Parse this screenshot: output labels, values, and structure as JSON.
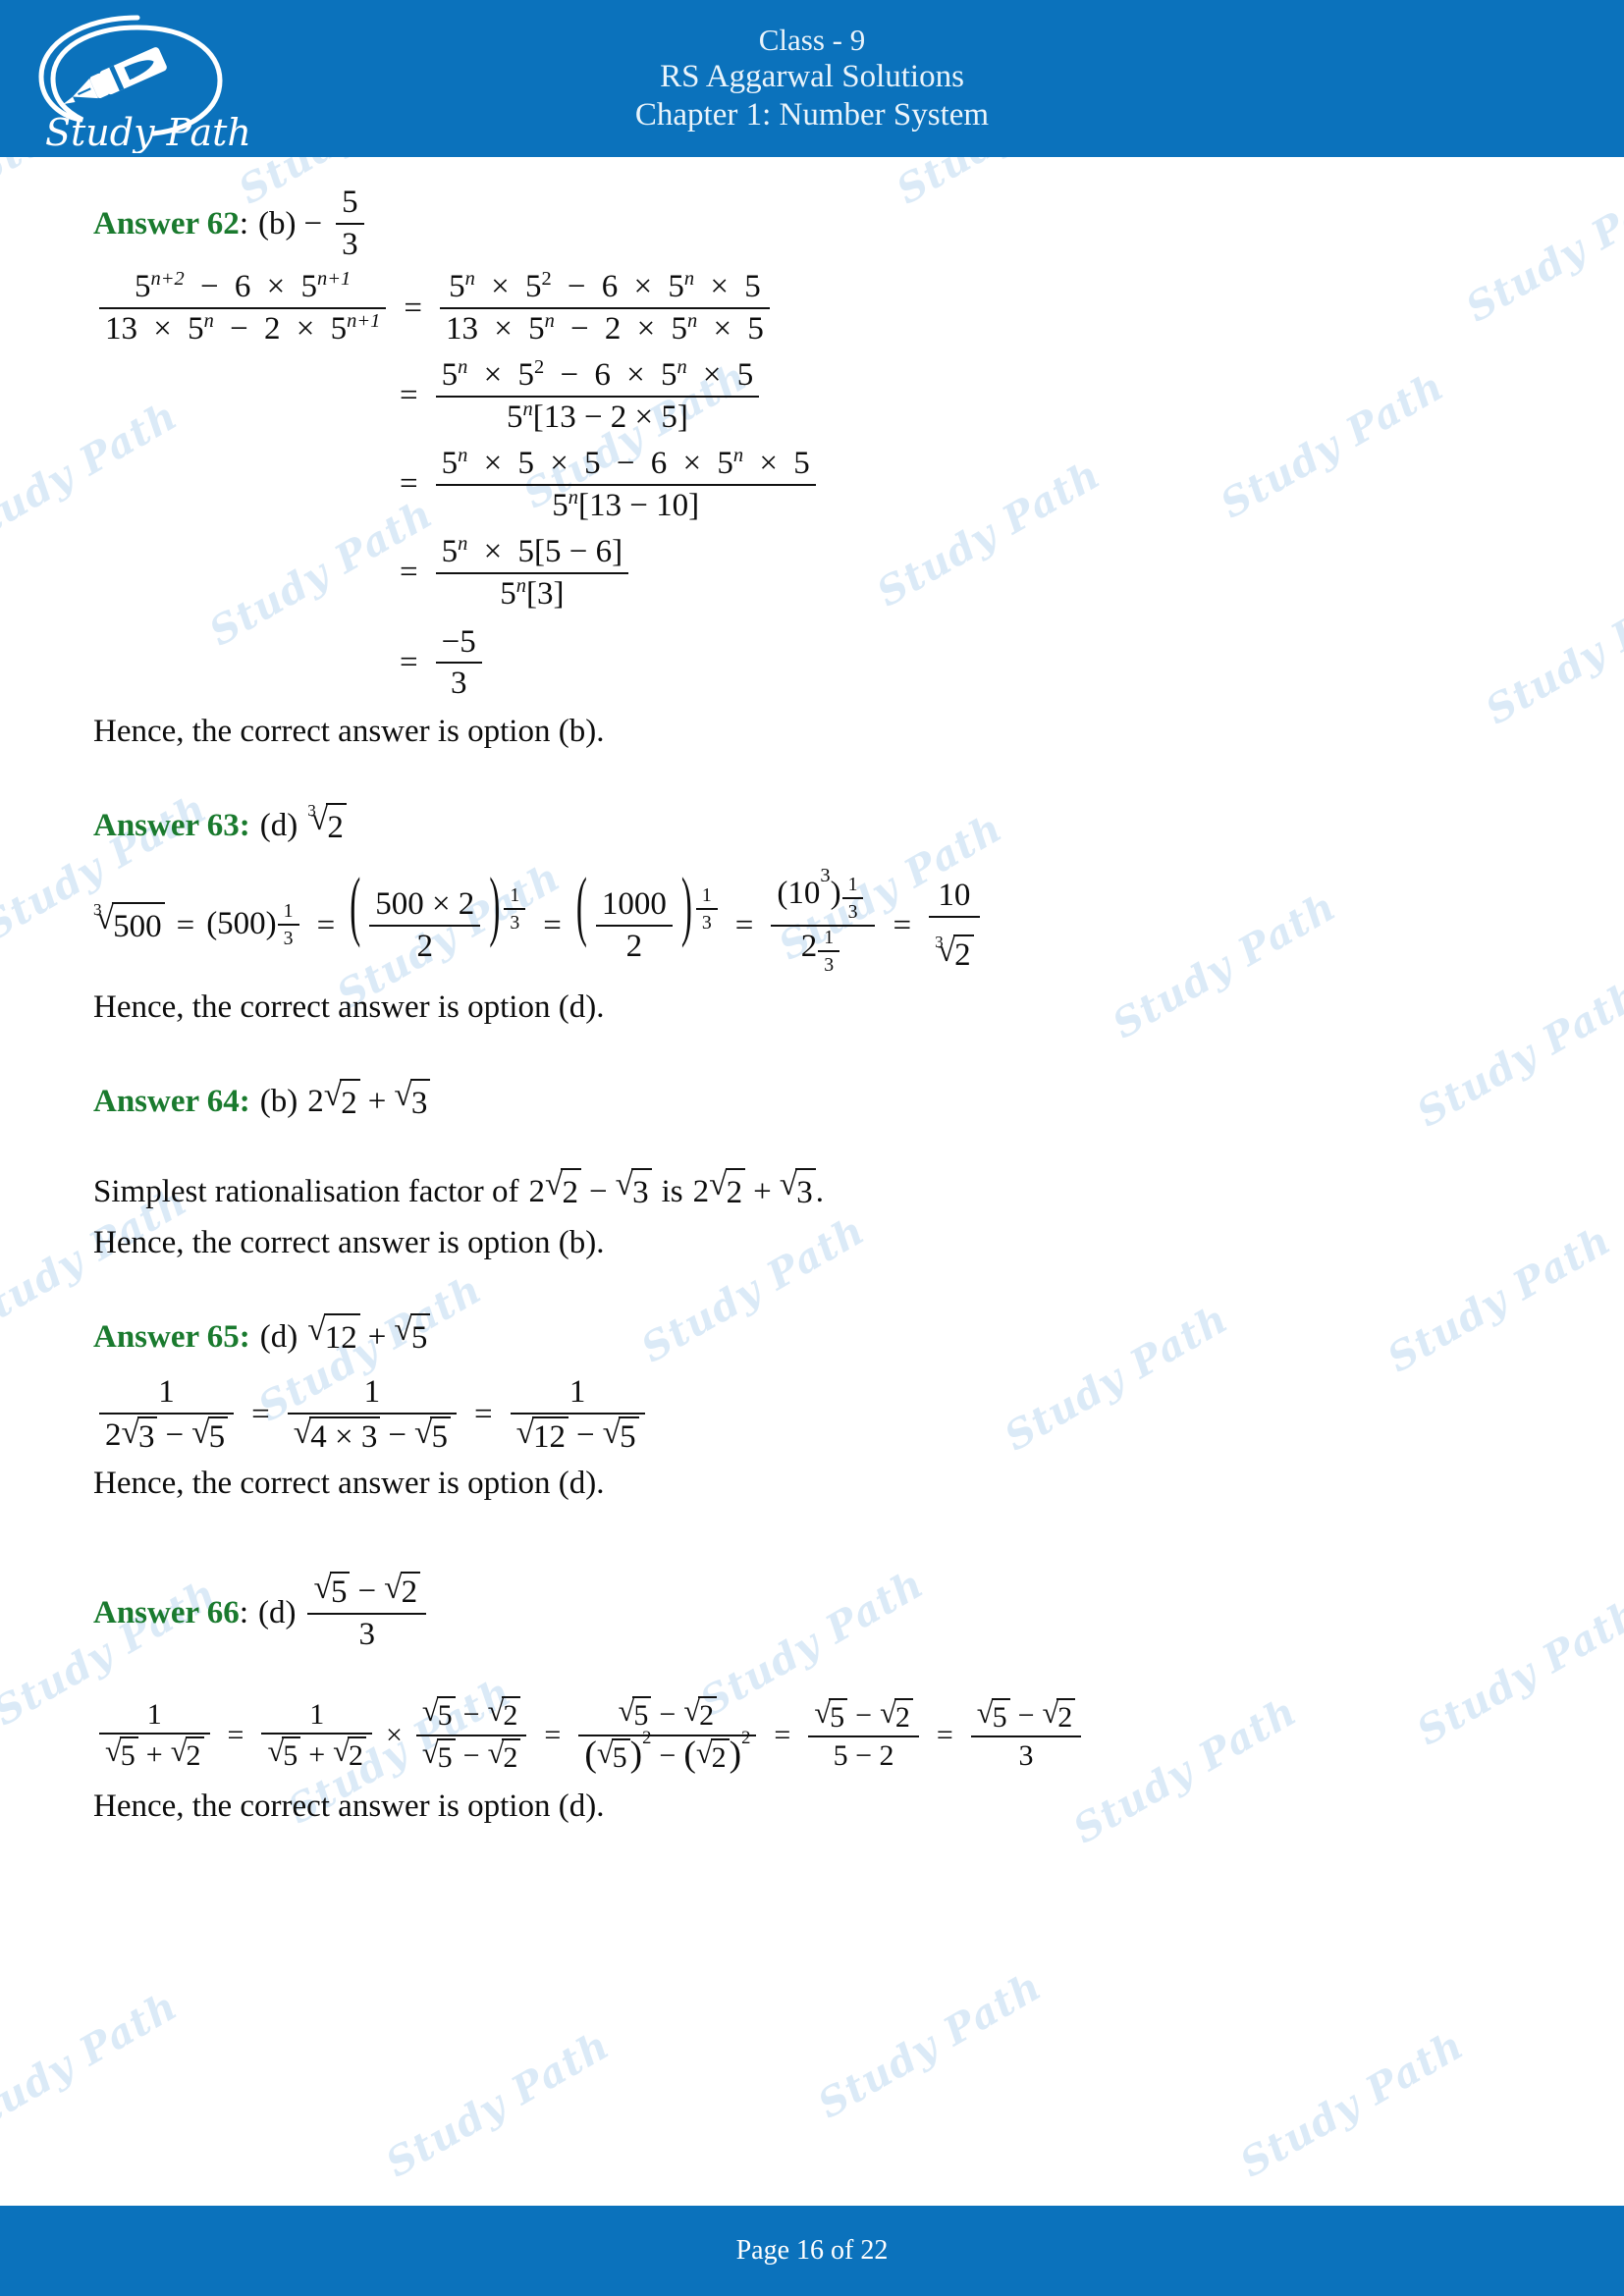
{
  "header": {
    "logo_alt": "Study Path",
    "logo_wordmark": "Study Path",
    "line1": "Class - 9",
    "line2": "RS Aggarwal Solutions",
    "line3": "Chapter 1: Number System",
    "bg_color": "#0B72BC",
    "text_color": "#eaf4fb"
  },
  "footer": {
    "page_text": "Page 16 of 22",
    "page_current": "16",
    "page_total": "22",
    "bg_color": "#0B72BC"
  },
  "watermark": {
    "text": "Study Path",
    "color": "#cfe4f5"
  },
  "answer_label_color": "#1a7a2e",
  "answers": [
    {
      "id": "62",
      "label": "Answer 62",
      "sep": ":",
      "option": "(b)",
      "result_sign": "−",
      "result_num": "5",
      "result_den": "3",
      "steps": {
        "s1_lhs_num": "5",
        "s1_lhs_num_exp": "n+2",
        "s1_lhs_num_rest_a": "6",
        "s1_lhs_num_rest_b": "5",
        "s1_lhs_num_rest_exp": "n+1",
        "s1_lhs_den_a": "13",
        "s1_lhs_den_b": "5",
        "s1_lhs_den_b_exp": "n",
        "s1_lhs_den_c": "2",
        "s1_lhs_den_d": "5",
        "s1_lhs_den_d_exp": "n+1",
        "s2_num": "5",
        "s2_num_exp": "n",
        "s2_num_b": "5",
        "s2_num_b_exp": "2",
        "s2_num_c": "6",
        "s2_num_d": "5",
        "s2_num_d_exp": "n",
        "s2_num_e": "5",
        "s2_den_a": "13",
        "s2_den_b": "5",
        "s2_den_b_exp": "n",
        "s2_den_c": "2",
        "s2_den_d": "5",
        "s2_den_d_exp": "n",
        "s2_den_e": "5",
        "s3_den_base": "5",
        "s3_den_exp": "n",
        "s3_den_bracket": "[13 − 2 × 5]",
        "s4_bracket": "[13 − 10]",
        "s5_num_bracket": "[5 − 6]",
        "s5_den_bracket": "[3]",
        "s6_num": "−5",
        "s6_den": "3"
      },
      "conclusion": "Hence, the correct answer is option (b)."
    },
    {
      "id": "63",
      "label": "Answer 63:",
      "option": "(d)",
      "result_index": "3",
      "result_radicand": "2",
      "steps": {
        "root_index": "3",
        "radicand": "500",
        "base": "(500)",
        "exp_num": "1",
        "exp_den": "3",
        "f1_num": "500 × 2",
        "f1_den": "2",
        "f2_num": "1000",
        "f2_den": "2",
        "f3_base": "(10",
        "f3_base_exp": "3",
        "f3_close": ")",
        "f3_den_base": "2",
        "f4_num": "10",
        "f4_den_index": "3",
        "f4_den_radicand": "2"
      },
      "conclusion": "Hence, the correct answer is option (d)."
    },
    {
      "id": "64",
      "label": "Answer 64:",
      "option": "(b)",
      "result_coeff": "2",
      "result_r1": "2",
      "result_op": "+",
      "result_r2": "3",
      "body_prefix": "Simplest rationalisation factor of",
      "body_a_coeff": "2",
      "body_a_r1": "2",
      "body_a_op": "−",
      "body_a_r2": "3",
      "body_mid": "is",
      "body_b_coeff": "2",
      "body_b_r1": "2",
      "body_b_op": "+",
      "body_b_r2": "3",
      "body_suffix": ".",
      "conclusion": "Hence, the correct answer is option (b)."
    },
    {
      "id": "65",
      "label": "Answer 65:",
      "option": "(d)",
      "result_r1": "12",
      "result_op": "+",
      "result_r2": "5",
      "steps": {
        "num": "1",
        "d1_coeff": "2",
        "d1_r1": "3",
        "d1_op": "−",
        "d1_r2": "5",
        "d2_r1": "4 × 3",
        "d2_op": "−",
        "d2_r2": "5",
        "d3_r1": "12",
        "d3_op": "−",
        "d3_r2": "5"
      },
      "conclusion": "Hence, the correct answer is option (d)."
    },
    {
      "id": "66",
      "label": "Answer 66",
      "sep": ":",
      "option": "(d)",
      "result_num_r1": "5",
      "result_num_op": "−",
      "result_num_r2": "2",
      "result_den": "3",
      "steps": {
        "num": "1",
        "den_r1": "5",
        "den_op": "+",
        "den_r2": "2",
        "mult_sign": "×",
        "f3_num_r1": "5",
        "f3_num_op": "−",
        "f3_num_r2": "2",
        "f3_den_r1": "5",
        "f3_den_op": "−",
        "f3_den_r2": "2",
        "f4_num_r1": "5",
        "f4_num_op": "−",
        "f4_num_r2": "2",
        "f4_den_a_r": "5",
        "f4_den_a_exp": "2",
        "f4_den_op": "−",
        "f4_den_b_r": "2",
        "f4_den_b_exp": "2",
        "f5_num_r1": "5",
        "f5_num_op": "−",
        "f5_num_r2": "2",
        "f5_den": "5 − 2",
        "f6_num_r1": "5",
        "f6_num_op": "−",
        "f6_num_r2": "2",
        "f6_den": "3"
      },
      "conclusion": "Hence, the correct answer is option (d)."
    }
  ]
}
